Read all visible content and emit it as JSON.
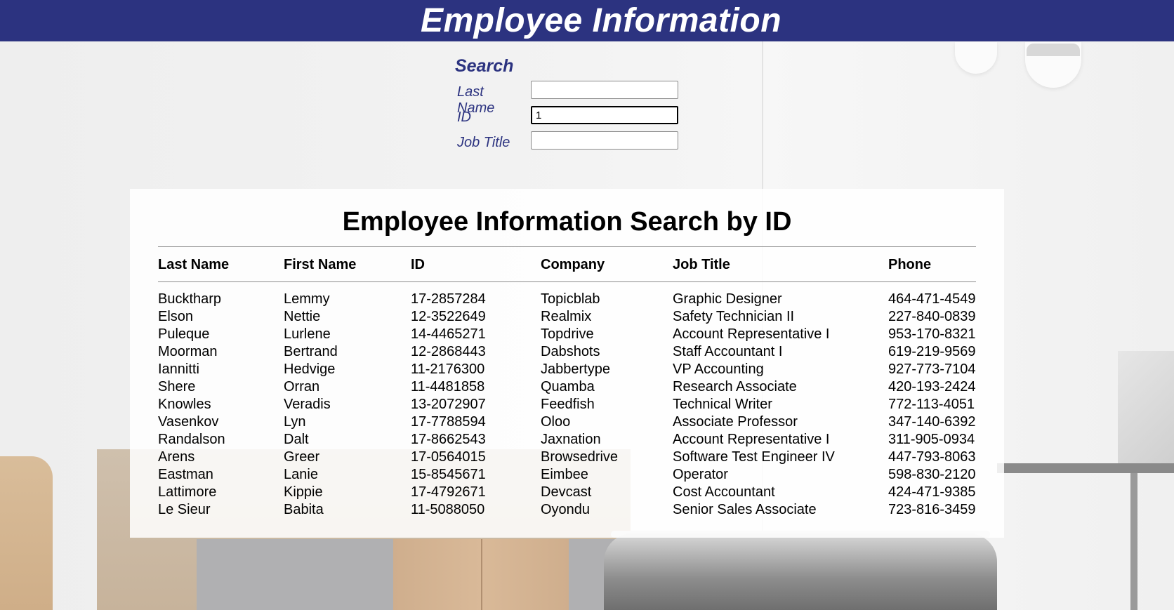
{
  "header": {
    "title": "Employee Information"
  },
  "search": {
    "heading": "Search",
    "fields": [
      {
        "label": "Last Name",
        "value": ""
      },
      {
        "label": "ID",
        "value": "1"
      },
      {
        "label": "Job Title",
        "value": ""
      }
    ]
  },
  "results": {
    "title": "Employee Information Search by ID",
    "columns": [
      "Last Name",
      "First Name",
      "ID",
      "Company",
      "Job Title",
      "Phone"
    ],
    "rows": [
      [
        "Bucktharp",
        "Lemmy",
        "17-2857284",
        "Topicblab",
        "Graphic Designer",
        "464-471-4549"
      ],
      [
        "Elson",
        "Nettie",
        "12-3522649",
        "Realmix",
        "Safety Technician II",
        "227-840-0839"
      ],
      [
        "Puleque",
        "Lurlene",
        "14-4465271",
        "Topdrive",
        "Account Representative I",
        "953-170-8321"
      ],
      [
        "Moorman",
        "Bertrand",
        "12-2868443",
        "Dabshots",
        "Staff Accountant I",
        "619-219-9569"
      ],
      [
        "Iannitti",
        "Hedvige",
        "11-2176300",
        "Jabbertype",
        "VP Accounting",
        "927-773-7104"
      ],
      [
        "Shere",
        "Orran",
        "11-4481858",
        "Quamba",
        "Research Associate",
        "420-193-2424"
      ],
      [
        "Knowles",
        "Veradis",
        "13-2072907",
        "Feedfish",
        "Technical Writer",
        "772-113-4051"
      ],
      [
        "Vasenkov",
        "Lyn",
        "17-7788594",
        "Oloo",
        "Associate Professor",
        "347-140-6392"
      ],
      [
        "Randalson",
        "Dalt",
        "17-8662543",
        "Jaxnation",
        "Account Representative I",
        "311-905-0934"
      ],
      [
        "Arens",
        "Greer",
        "17-0564015",
        "Browsedrive",
        "Software Test Engineer IV",
        "447-793-8063"
      ],
      [
        "Eastman",
        "Lanie",
        "15-8545671",
        "Eimbee",
        "Operator",
        "598-830-2120"
      ],
      [
        "Lattimore",
        "Kippie",
        "17-4792671",
        "Devcast",
        "Cost Accountant",
        "424-471-9385"
      ],
      [
        "Le Sieur",
        "Babita",
        "11-5088050",
        "Oyondu",
        "Senior Sales Associate",
        "723-816-3459"
      ]
    ]
  },
  "colors": {
    "header_bg": "#2c3380",
    "accent_text": "#2c3380",
    "panel_bg": "#ffffff"
  }
}
